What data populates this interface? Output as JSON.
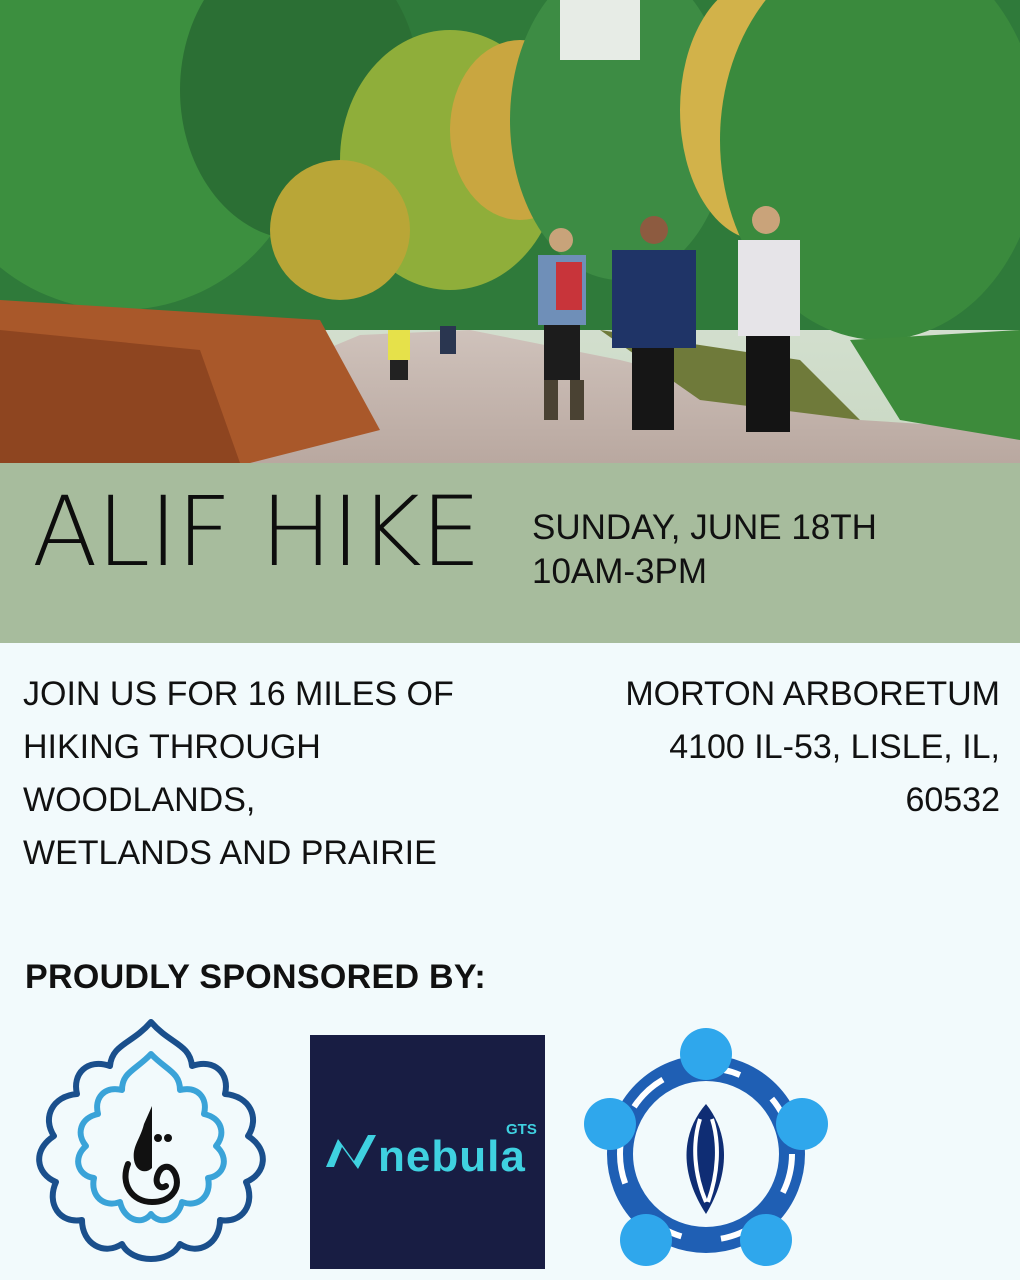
{
  "hero": {
    "alt": "Family hiking on a forest trail"
  },
  "event": {
    "title": "ALIF HIKE",
    "date": "SUNDAY, JUNE 18TH",
    "time": "10AM-3PM"
  },
  "description": {
    "lines": [
      "JOIN US FOR 16 MILES OF",
      "HIKING THROUGH",
      "WOODLANDS,",
      "WETLANDS AND PRAIRIE"
    ]
  },
  "location": {
    "lines": [
      "MORTON ARBORETUM",
      "4100 IL-53, LISLE, IL,",
      "60532"
    ]
  },
  "sponsors": {
    "heading": "PROUDLY SPONSORED BY:",
    "nebula_name": "nebula",
    "nebula_suffix": "GTS"
  },
  "colors": {
    "band": "#a7bc9d",
    "background": "#f2fafc",
    "nebula_bg": "#181d43",
    "nebula_accent": "#3fd1e0",
    "logo_blue": "#1f7fc4"
  }
}
